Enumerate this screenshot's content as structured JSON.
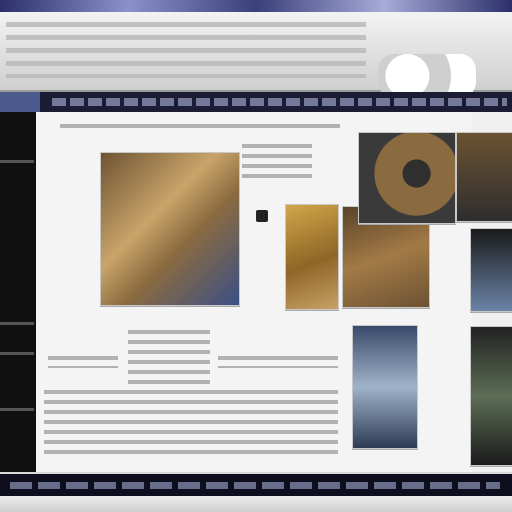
{
  "page": {
    "title": "",
    "nav_items": [],
    "footer_items": []
  },
  "content": {
    "heading": "",
    "paragraphs": []
  },
  "colors": {
    "nav_bar": "#1c1c34",
    "footer_bar": "#0e0e1e",
    "content_bg": "#f4f4f4"
  }
}
